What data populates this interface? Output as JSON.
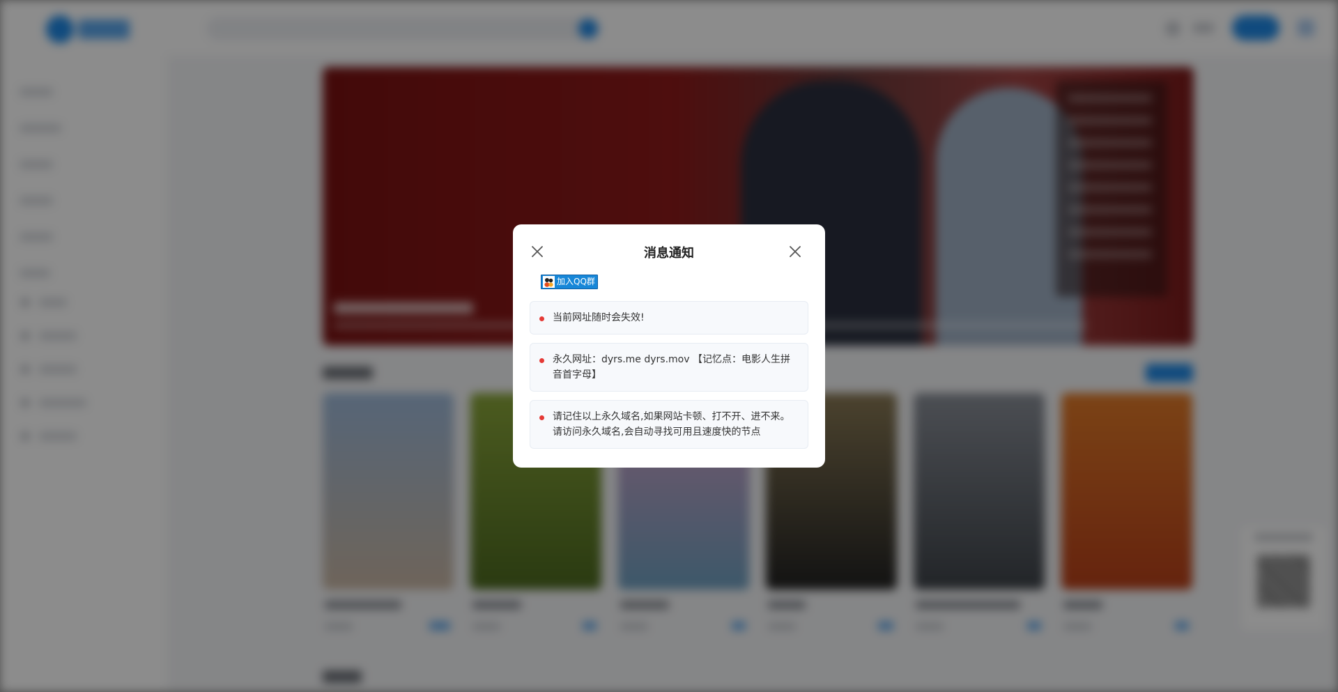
{
  "modal": {
    "title": "消息通知",
    "qq_group_label": "加入QQ群",
    "notices": [
      "当前网址随时会失效!",
      "永久网址：dyrs.me dyrs.mov 【记忆点：电影人生拼音首字母】",
      "请记住以上永久域名,如果网站卡顿、打不开、进不来。请访问永久域名,会自动寻找可用且速度快的节点"
    ]
  },
  "icons": {
    "close": "close-icon",
    "qq": "qq-group-icon",
    "bullet": "red-dot"
  },
  "colors": {
    "accent": "#1e88e5",
    "bullet": "#e53935",
    "qq_button": "#1787d8",
    "notice_bg": "#f7f9fc"
  }
}
